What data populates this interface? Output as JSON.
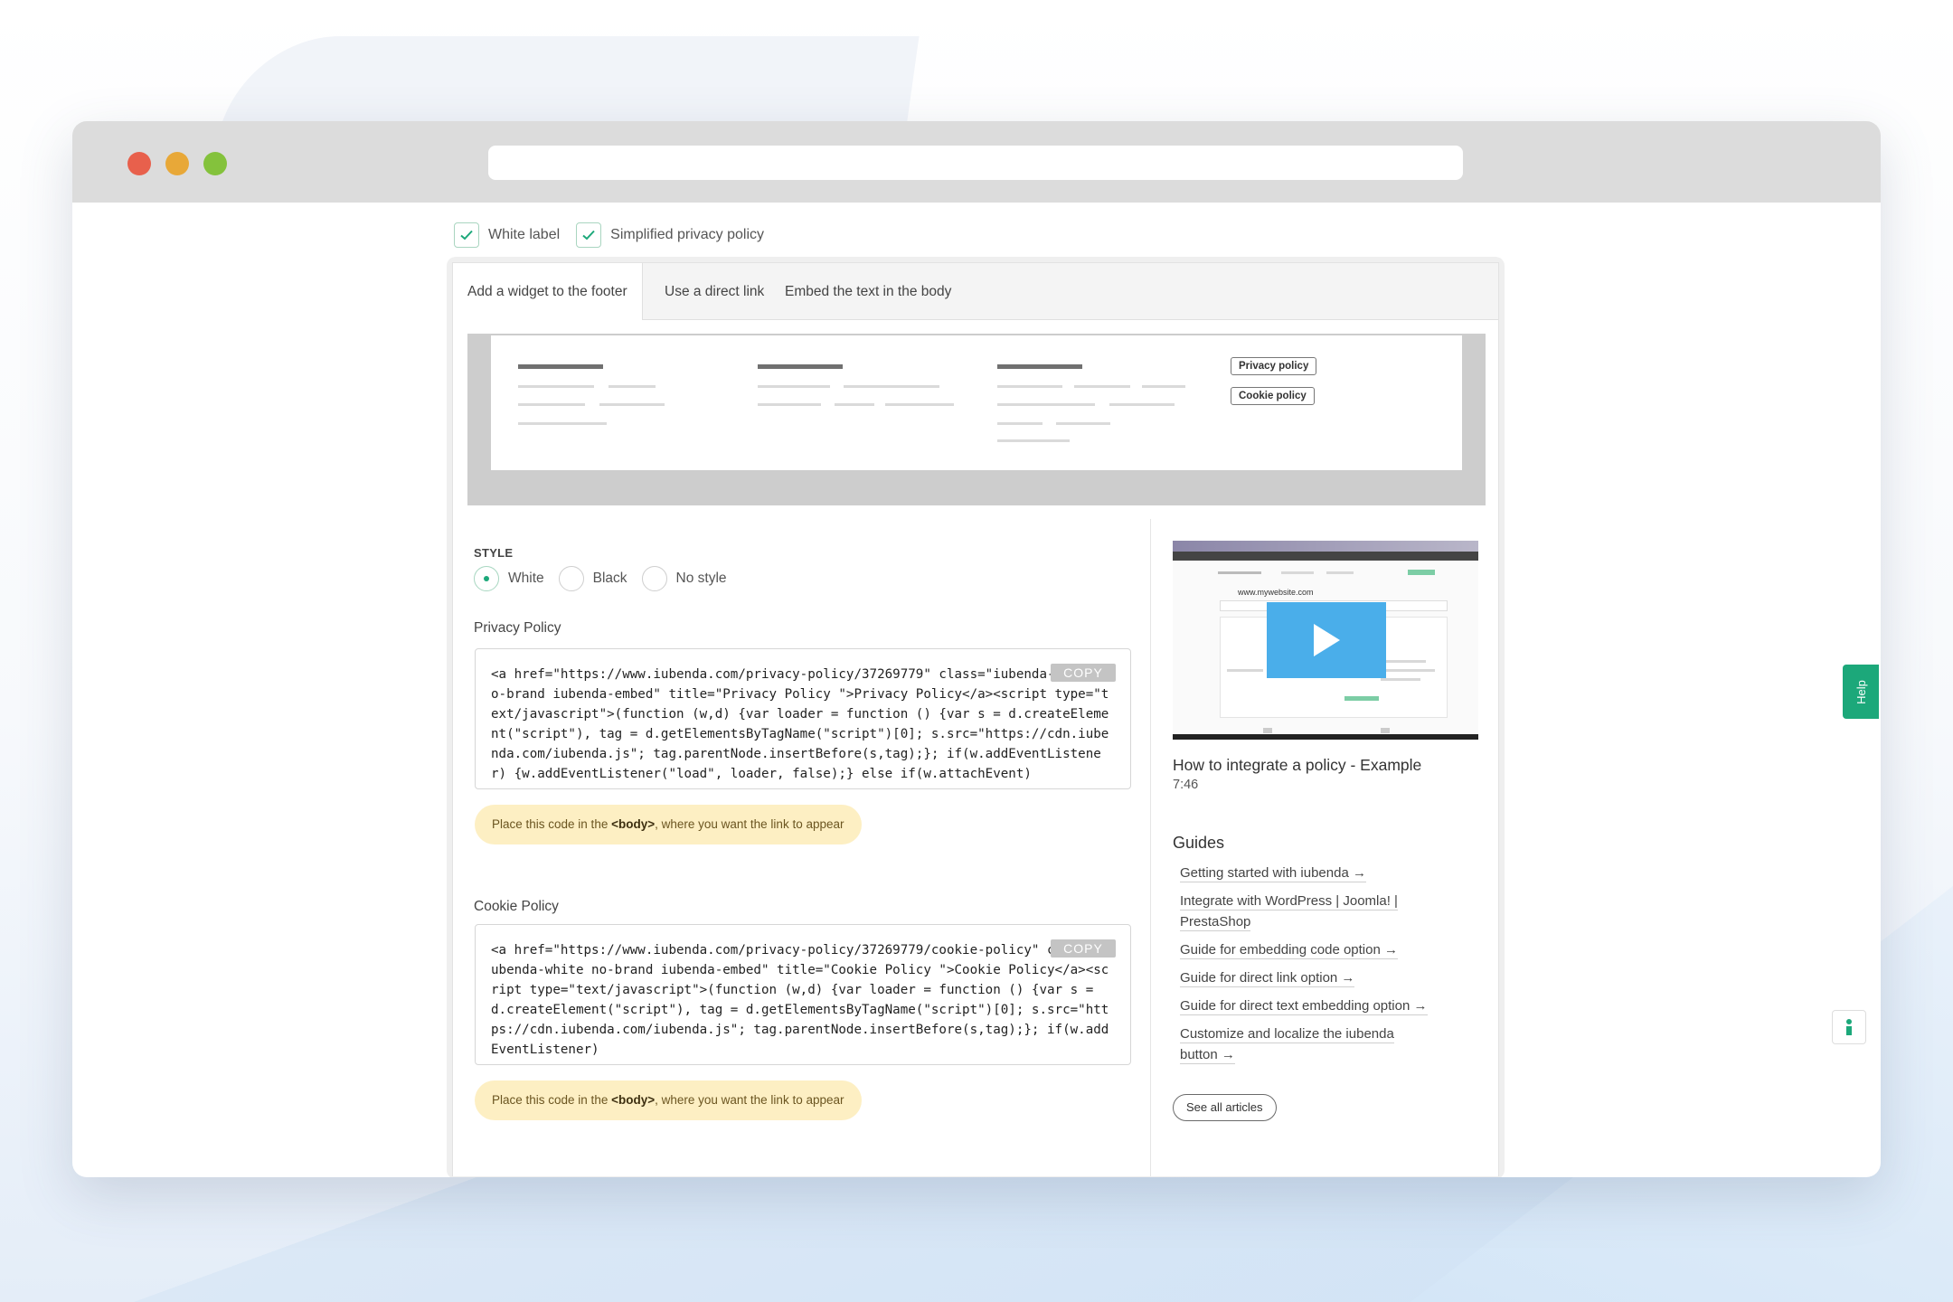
{
  "options": {
    "white_label": "White label",
    "simplified_policy": "Simplified privacy policy"
  },
  "tabs": [
    {
      "label": "Add a widget to the footer",
      "active": true
    },
    {
      "label": "Use a direct link",
      "active": false
    },
    {
      "label": "Embed the text in the body",
      "active": false
    }
  ],
  "preview": {
    "privacy_button": "Privacy policy",
    "cookie_button": "Cookie policy"
  },
  "style": {
    "label": "STYLE",
    "options": [
      {
        "label": "White",
        "selected": true
      },
      {
        "label": "Black",
        "selected": false
      },
      {
        "label": "No style",
        "selected": false
      }
    ]
  },
  "privacy_policy": {
    "label": "Privacy Policy",
    "code": "<a href=\"https://www.iubenda.com/privacy-policy/37269779\" class=\"iubenda-white no-brand iubenda-embed\" title=\"Privacy Policy \">Privacy Policy</a><script type=\"text/javascript\">(function (w,d) {var loader = function () {var s = d.createElement(\"script\"), tag = d.getElementsByTagName(\"script\")[0]; s.src=\"https://cdn.iubenda.com/iubenda.js\"; tag.parentNode.insertBefore(s,tag);}; if(w.addEventListener) {w.addEventListener(\"load\", loader, false);} else if(w.attachEvent)",
    "copy_label": "COPY",
    "hint_prefix": "Place this code in the ",
    "hint_tag": "<body>",
    "hint_suffix": ", where you want the link to appear"
  },
  "cookie_policy": {
    "label": "Cookie Policy",
    "code": "<a href=\"https://www.iubenda.com/privacy-policy/37269779/cookie-policy\" class=\"iubenda-white no-brand iubenda-embed\" title=\"Cookie Policy \">Cookie Policy</a><script type=\"text/javascript\">(function (w,d) {var loader = function () {var s = d.createElement(\"script\"), tag = d.getElementsByTagName(\"script\")[0]; s.src=\"https://cdn.iubenda.com/iubenda.js\"; tag.parentNode.insertBefore(s,tag);}; if(w.addEventListener)",
    "copy_label": "COPY",
    "hint_prefix": "Place this code in the ",
    "hint_tag": "<body>",
    "hint_suffix": ", where you want the link to appear"
  },
  "video": {
    "site_text": "www.mywebsite.com",
    "title": "How to integrate a policy - Example",
    "duration": "7:46"
  },
  "guides": {
    "title": "Guides",
    "items": [
      "Getting started with iubenda →",
      "Integrate with WordPress | Joomla! | PrestaShop",
      "Guide for embedding code option →",
      "Guide for direct link option →",
      "Guide for direct text embedding option →",
      "Customize and localize the iubenda button →"
    ],
    "see_all": "See all articles"
  },
  "help_label": "Help",
  "colors": {
    "accent_green": "#1ca87a",
    "hint_bg": "#fdefc3",
    "play_blue": "#4aaeea"
  }
}
